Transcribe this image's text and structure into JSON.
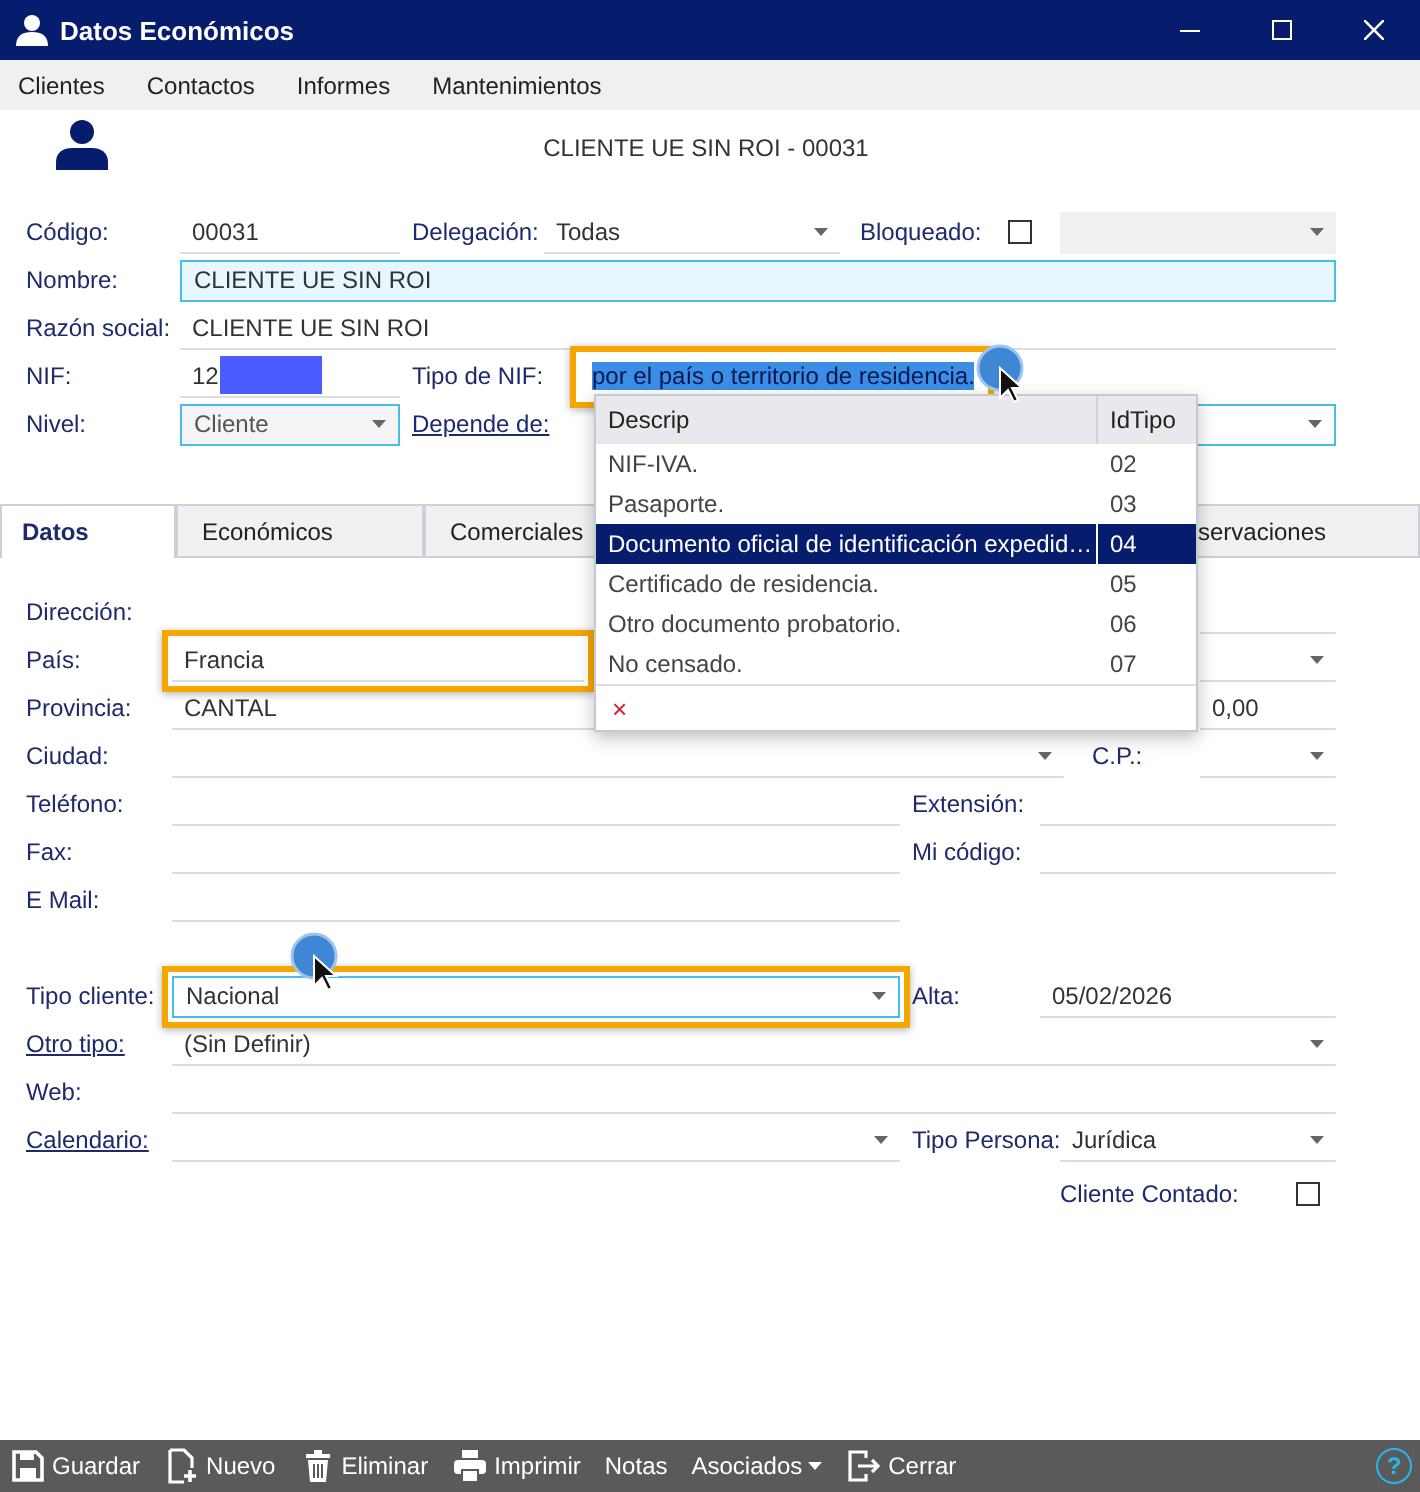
{
  "window": {
    "title": "Datos Económicos"
  },
  "menu": [
    "Clientes",
    "Contactos",
    "Informes",
    "Mantenimientos"
  ],
  "record_title": "CLIENTE UE SIN ROI - 00031",
  "header_fields": {
    "codigo": {
      "label": "Código:",
      "value": "00031"
    },
    "delegacion": {
      "label": "Delegación:",
      "value": "Todas"
    },
    "bloqueado": {
      "label": "Bloqueado:",
      "checked": false
    },
    "nombre": {
      "label": "Nombre:",
      "value": "CLIENTE UE SIN ROI"
    },
    "razon_social": {
      "label": "Razón social:",
      "value": "CLIENTE UE SIN ROI"
    },
    "nif": {
      "label": "NIF:",
      "value": "12"
    },
    "tipo_nif": {
      "label": "Tipo de NIF:",
      "value": "por el país o territorio de residencia.",
      "highlighted": true,
      "text_selected": true
    },
    "nivel": {
      "label": "Nivel:",
      "value": "Cliente"
    },
    "depende_de": {
      "label": "Depende de:",
      "link": true
    }
  },
  "tabs": [
    {
      "label": "Datos",
      "selected": true
    },
    {
      "label": "Económicos",
      "selected": false
    },
    {
      "label": "Comerciales",
      "selected": false
    },
    {
      "label": "servaciones",
      "selected": false
    }
  ],
  "datos": {
    "direccion": {
      "label": "Dirección:"
    },
    "pais": {
      "label": "País:",
      "value": "Francia",
      "highlighted": true
    },
    "provincia": {
      "label": "Provincia:",
      "value": "CANTAL"
    },
    "importe": {
      "value": "0,00"
    },
    "ciudad": {
      "label": "Ciudad:"
    },
    "cp": {
      "label": "C.P.:"
    },
    "telefono": {
      "label": "Teléfono:"
    },
    "extension": {
      "label": "Extensión:"
    },
    "fax": {
      "label": "Fax:"
    },
    "mi_codigo": {
      "label": "Mi código:"
    },
    "email": {
      "label": "E Mail:"
    },
    "tipo_cliente": {
      "label": "Tipo cliente:",
      "value": "Nacional",
      "highlighted": true
    },
    "alta": {
      "label": "Alta:",
      "value": "05/02/2026"
    },
    "otro_tipo": {
      "label": "Otro tipo:",
      "value": "(Sin Definir)",
      "link": true
    },
    "web": {
      "label": "Web:"
    },
    "calendario": {
      "label": "Calendario:",
      "link": true
    },
    "tipo_persona": {
      "label": "Tipo Persona:",
      "value": "Jurídica"
    },
    "cliente_contado": {
      "label": "Cliente Contado:",
      "checked": false
    }
  },
  "dropdown": {
    "columns": [
      "Descrip",
      "IdTipo"
    ],
    "rows": [
      {
        "descrip": "NIF-IVA.",
        "id": "02",
        "selected": false
      },
      {
        "descrip": "Pasaporte.",
        "id": "03",
        "selected": false
      },
      {
        "descrip": "Documento oficial de identificación expedid…",
        "id": "04",
        "selected": true
      },
      {
        "descrip": "Certificado de residencia.",
        "id": "05",
        "selected": false
      },
      {
        "descrip": "Otro documento probatorio.",
        "id": "06",
        "selected": false
      },
      {
        "descrip": "No censado.",
        "id": "07",
        "selected": false
      }
    ],
    "clear": "×"
  },
  "toolbar": [
    {
      "label": "Guardar",
      "kind": "save"
    },
    {
      "label": "Nuevo",
      "kind": "new"
    },
    {
      "label": "Eliminar",
      "kind": "delete"
    },
    {
      "label": "Imprimir",
      "kind": "print"
    },
    {
      "label": "Notas",
      "kind": "plain"
    },
    {
      "label": "Asociados",
      "kind": "menu"
    },
    {
      "label": "Cerrar",
      "kind": "exit"
    }
  ],
  "help": "?"
}
